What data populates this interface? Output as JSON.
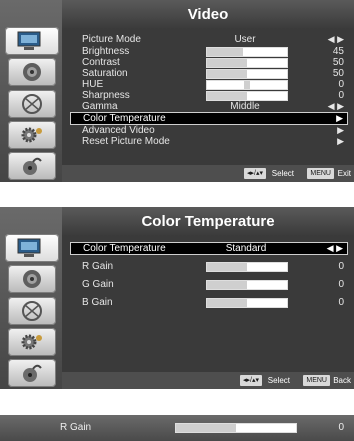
{
  "video_menu": {
    "title": "Video",
    "items": [
      {
        "label": "Picture Mode",
        "type": "option",
        "value": "User"
      },
      {
        "label": "Brightness",
        "type": "slider",
        "value": "45",
        "level": 0.45
      },
      {
        "label": "Contrast",
        "type": "slider",
        "value": "50",
        "level": 0.5
      },
      {
        "label": "Saturation",
        "type": "slider",
        "value": "50",
        "level": 0.5
      },
      {
        "label": "HUE",
        "type": "center-slider",
        "value": "0",
        "level": 0.5
      },
      {
        "label": "Sharpness",
        "type": "slider",
        "value": "0",
        "level": 0.5
      },
      {
        "label": "Gamma",
        "type": "option",
        "value": "Middle"
      },
      {
        "label": "Color Temperature",
        "type": "submenu",
        "selected": true
      },
      {
        "label": "Advanced Video",
        "type": "submenu"
      },
      {
        "label": "Reset Picture Mode",
        "type": "submenu"
      }
    ],
    "footer": {
      "nav_keys": "◂▸/▴▾",
      "select_label": "Select",
      "menu_key": "MENU",
      "exit_label": "Exit"
    }
  },
  "color_temp_menu": {
    "title": "Color Temperature",
    "items": [
      {
        "label": "Color Temperature",
        "type": "option",
        "value": "Standard",
        "selected": true
      },
      {
        "label": "R Gain",
        "type": "slider",
        "value": "0",
        "level": 0.5
      },
      {
        "label": "G Gain",
        "type": "slider",
        "value": "0",
        "level": 0.5
      },
      {
        "label": "B Gain",
        "type": "slider",
        "value": "0",
        "level": 0.5
      }
    ],
    "footer": {
      "nav_keys": "◂▸/▴▾",
      "select_label": "Select",
      "menu_key": "MENU",
      "back_label": "Back"
    }
  },
  "adjust_bar": {
    "label": "R Gain",
    "value": "0",
    "level": 0.5
  },
  "glyphs": {
    "left_right": "◀ ▶",
    "right": "▶"
  },
  "side_icons": [
    "tv-icon",
    "speaker-icon",
    "satellite-icon",
    "gear-icon",
    "lock-icon"
  ]
}
